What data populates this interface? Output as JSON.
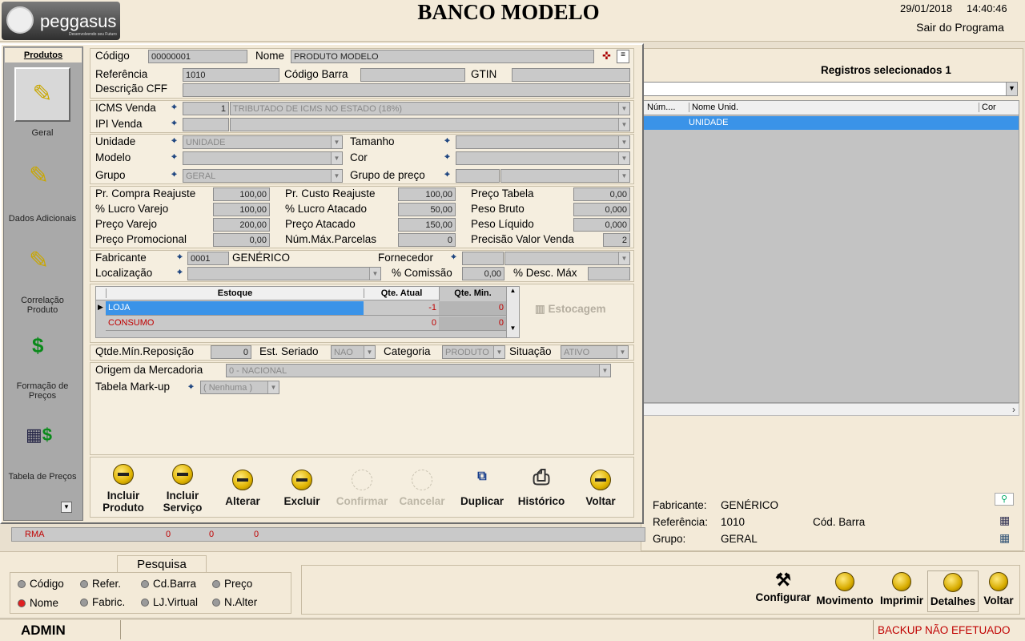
{
  "header": {
    "logo": "peggasus",
    "logo_tagline": "Desenvolvendo seu Futuro",
    "title": "BANCO MODELO",
    "date": "29/01/2018",
    "time": "14:40:46",
    "exit_label": "Sair do Programa"
  },
  "right_panel": {
    "selected_label": "Registros selecionados",
    "selected_count": "1",
    "columns": [
      "Núm....",
      "Nome Unid.",
      "Cor"
    ],
    "row": {
      "nome_unid": "UNIDADE"
    },
    "details": {
      "fabricante_label": "Fabricante:",
      "fabricante": "GENÉRICO",
      "referencia_label": "Referência:",
      "referencia": "1010",
      "cod_barra_label": "Cód. Barra",
      "grupo_label": "Grupo:",
      "grupo": "GERAL"
    }
  },
  "sidebar": {
    "header": "Produtos",
    "items": [
      "Geral",
      "Dados Adicionais",
      "Correlação Produto",
      "Formação de Preços",
      "Tabela de Preços"
    ]
  },
  "form": {
    "codigo_label": "Código",
    "codigo": "00000001",
    "nome_label": "Nome",
    "nome": "PRODUTO MODELO",
    "referencia_label": "Referência",
    "referencia": "1010",
    "codbarra_label": "Código Barra",
    "gtin_label": "GTIN",
    "descricao_label": "Descrição CFF",
    "icms_label": "ICMS Venda",
    "icms_code": "1",
    "icms_desc": "TRIBUTADO DE ICMS NO ESTADO (18%)",
    "ipi_label": "IPI Venda",
    "unidade_label": "Unidade",
    "unidade": "UNIDADE",
    "tamanho_label": "Tamanho",
    "modelo_label": "Modelo",
    "cor_label": "Cor",
    "grupo_label": "Grupo",
    "grupo": "GERAL",
    "grupopreco_label": "Grupo de preço",
    "prices": {
      "pcompra_label": "Pr. Compra Reajuste",
      "pcompra": "100,00",
      "pcusto_label": "Pr. Custo Reajuste",
      "pcusto": "100,00",
      "ptabela_label": "Preço Tabela",
      "ptabela": "0,00",
      "lvarejo_label": "% Lucro Varejo",
      "lvarejo": "100,00",
      "latacado_label": "% Lucro Atacado",
      "latacado": "50,00",
      "pbruto_label": "Peso Bruto",
      "pbruto": "0,000",
      "pvarejo_label": "Preço Varejo",
      "pvarejo": "200,00",
      "patacado_label": "Preço Atacado",
      "patacado": "150,00",
      "pliquido_label": "Peso Líquido",
      "pliquido": "0,000",
      "ppromo_label": "Preço Promocional",
      "ppromo": "0,00",
      "parcelas_label": "Núm.Máx.Parcelas",
      "parcelas": "0",
      "precisao_label": "Precisão Valor Venda",
      "precisao": "2"
    },
    "fabricante_label": "Fabricante",
    "fabricante_code": "0001",
    "fabricante": "GENÉRICO",
    "fornecedor_label": "Fornecedor",
    "localizacao_label": "Localização",
    "comissao_label": "% Comissão",
    "comissao": "0,00",
    "desconto_label": "% Desc. Máx",
    "stock": {
      "headers": [
        "Estoque",
        "Qte. Atual",
        "Qte. Min."
      ],
      "rows": [
        [
          "LOJA",
          "-1",
          "0"
        ],
        [
          "CONSUMO",
          "0",
          "0"
        ]
      ],
      "estocagem": "Estocagem"
    },
    "qtdemin_label": "Qtde.Mín.Reposição",
    "qtdemin": "0",
    "seriado_label": "Est. Seriado",
    "seriado": "NAO",
    "categoria_label": "Categoria",
    "categoria": "PRODUTO",
    "situacao_label": "Situação",
    "situacao": "ATIVO",
    "origem_label": "Origem da Mercadoria",
    "origem": "0 - NACIONAL",
    "markup_label": "Tabela Mark-up",
    "markup": "( Nenhuma )"
  },
  "actions": [
    {
      "l1": "Incluir",
      "l2": "Produto"
    },
    {
      "l1": "Incluir",
      "l2": "Serviço"
    },
    {
      "l1": "Alterar",
      "l2": ""
    },
    {
      "l1": "Excluir",
      "l2": ""
    },
    {
      "l1": "Confirmar",
      "l2": ""
    },
    {
      "l1": "Cancelar",
      "l2": ""
    },
    {
      "l1": "Duplicar",
      "l2": ""
    },
    {
      "l1": "Histórico",
      "l2": ""
    },
    {
      "l1": "Voltar",
      "l2": ""
    }
  ],
  "rma_row": {
    "label": "RMA",
    "v1": "0",
    "v2": "0",
    "v3": "0"
  },
  "pesquisa": {
    "title": "Pesquisa",
    "options": [
      "Código",
      "Refer.",
      "Cd.Barra",
      "Preço",
      "Nome",
      "Fabric.",
      "LJ.Virtual",
      "N.Alter"
    ]
  },
  "toolbar": [
    "Configurar",
    "Movimento",
    "Imprimir",
    "Detalhes",
    "Voltar"
  ],
  "status": {
    "user": "ADMIN",
    "backup": "BACKUP NÃO EFETUADO"
  }
}
